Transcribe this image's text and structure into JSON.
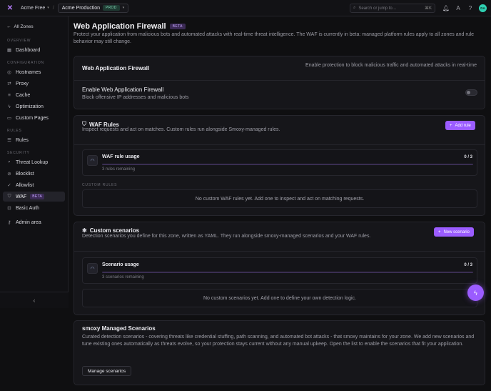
{
  "topbar": {
    "org_label": "Acme Free",
    "zone_label": "Acme Production",
    "zone_badge": "PROD",
    "search_placeholder": "Search or jump to…",
    "search_shortcut": "⌘K",
    "avatar_initials": "DA"
  },
  "sidebar": {
    "back_label": "All Zones",
    "sections": {
      "overview": "OVERVIEW",
      "configuration": "CONFIGURATION",
      "rules": "RULES",
      "security": "SECURITY"
    },
    "items": [
      {
        "label": "Dashboard",
        "icon": "grid-icon"
      },
      {
        "label": "Hostnames",
        "icon": "globe-icon"
      },
      {
        "label": "Proxy",
        "icon": "proxy-icon"
      },
      {
        "label": "Cache",
        "icon": "database-icon"
      },
      {
        "label": "Optimization",
        "icon": "bolt-icon"
      },
      {
        "label": "Custom Pages",
        "icon": "document-icon"
      },
      {
        "label": "Rules",
        "icon": "list-icon"
      },
      {
        "label": "Threat Lookup",
        "icon": "search-icon"
      },
      {
        "label": "Blocklist",
        "icon": "ban-icon"
      },
      {
        "label": "Allowlist",
        "icon": "check-circle-icon"
      },
      {
        "label": "WAF",
        "icon": "shield-icon",
        "badge": "BETA",
        "active": true
      },
      {
        "label": "Basic Auth",
        "icon": "lock-icon"
      },
      {
        "label": "Admin area",
        "icon": "key-icon"
      }
    ]
  },
  "page": {
    "title": "Web Application Firewall",
    "title_badge": "BETA",
    "subtitle": "Protect your application from malicious bots and automated attacks with real-time threat intelligence. The WAF is currently in beta: managed platform rules apply to all zones and rule behavior may still change."
  },
  "waf_card": {
    "title": "Web Application Firewall",
    "header_note": "Enable protection to block malicious traffic and automated attacks in real-time",
    "toggle_title": "Enable Web Application Firewall",
    "toggle_desc": "Block offensive IP addresses and malicious bots",
    "enabled": false
  },
  "rules_card": {
    "title": "WAF Rules",
    "desc": "Inspect requests and act on matches. Custom rules run alongside Smoxy-managed rules.",
    "add_button": "Add rule",
    "usage_title": "WAF rule usage",
    "usage_count": "0 / 3",
    "usage_fraction": 0,
    "usage_remaining": "3 rules remaining",
    "section_label": "CUSTOM RULES",
    "empty_text": "No custom WAF rules yet. Add one to inspect and act on matching requests."
  },
  "scenarios_card": {
    "title": "Custom scenarios",
    "desc": "Detection scenarios you define for this zone, written as YAML. They run alongside smoxy-managed scenarios and your WAF rules.",
    "new_button": "New scenario",
    "usage_title": "Scenario usage",
    "usage_count": "0 / 3",
    "usage_fraction": 0,
    "usage_remaining": "3 scenarios remaining",
    "empty_text": "No custom scenarios yet. Add one to define your own detection logic."
  },
  "managed_card": {
    "title": "smoxy Managed Scenarios",
    "desc": "Curated detection scenarios - covering threats like credential stuffing, path scanning, and automated bot attacks - that smoxy maintains for your zone. We add new scenarios and tune existing ones automatically as threats evolve, so your protection stays current without any manual upkeep. Open the list to enable the scenarios that fit your application.",
    "button": "Manage scenarios"
  },
  "colors": {
    "accent": "#9b5cff",
    "background": "#0f0f11",
    "card": "#16161a",
    "prod_badge": "#7fd3b4"
  }
}
